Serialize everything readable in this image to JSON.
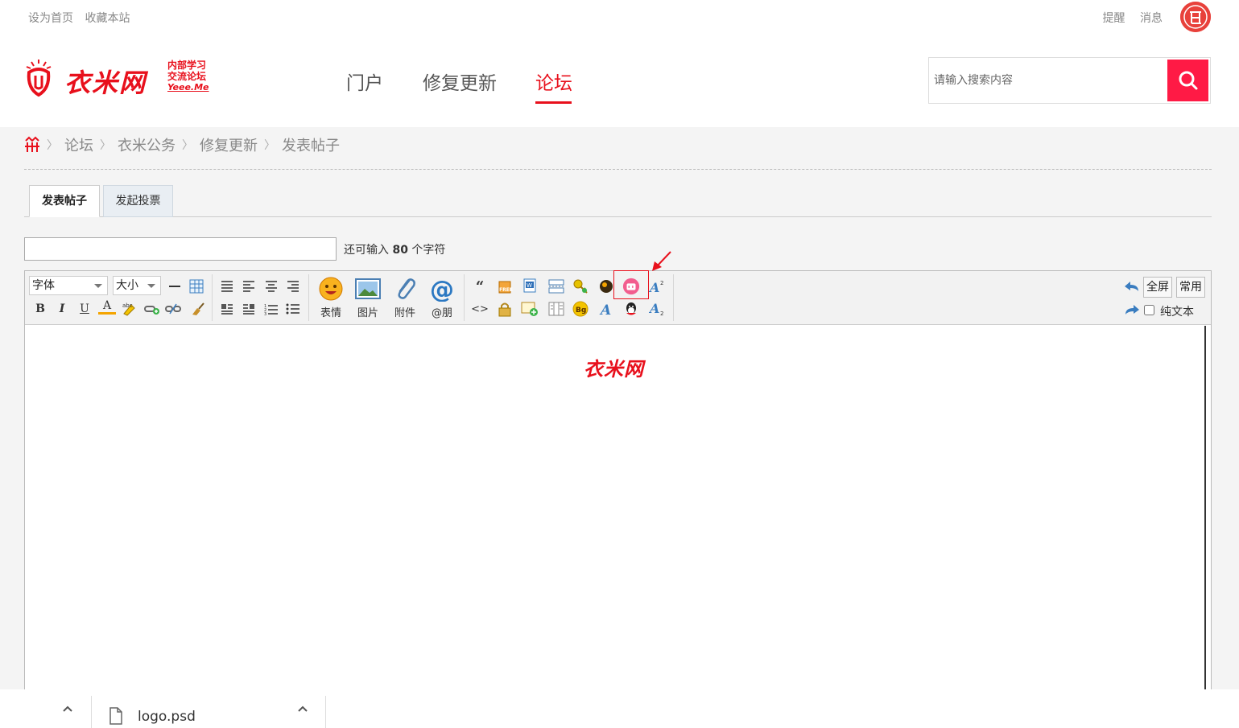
{
  "topbar": {
    "set_home": "设为首页",
    "bookmark": "收藏本站",
    "remind": "提醒",
    "messages": "消息",
    "avatar_glyph": "伀"
  },
  "logo": {
    "name": "衣米网",
    "sub_line1": "内部学习",
    "sub_line2": "交流论坛",
    "sub_url": "Yeee.Me"
  },
  "nav": {
    "items": [
      {
        "label": "门户",
        "active": false
      },
      {
        "label": "修复更新",
        "active": false
      },
      {
        "label": "论坛",
        "active": true
      }
    ]
  },
  "search": {
    "placeholder": "请输入搜索内容",
    "button_icon": "search-icon"
  },
  "breadcrumb": {
    "home_icon": "home-icon",
    "items": [
      "论坛",
      "衣米公务",
      "修复更新",
      "发表帖子"
    ]
  },
  "tabs": [
    {
      "label": "发表帖子",
      "active": true
    },
    {
      "label": "发起投票",
      "active": false
    }
  ],
  "subject": {
    "value": "",
    "remain_prefix": "还可输入",
    "remain_count": "80",
    "remain_suffix": "个字符"
  },
  "toolbar": {
    "font_select": "字体",
    "size_select": "大小",
    "bold": "B",
    "italic": "I",
    "underline": "U",
    "font_color": "A",
    "emoji_label": "表情",
    "image_label": "图片",
    "attach_label": "附件",
    "at_label": "@朋",
    "quote": "“",
    "code": "<>",
    "fullscreen": "全屏",
    "common": "常用",
    "plain_text": "纯文本",
    "plain_checked": false
  },
  "editor": {
    "watermark": "衣米网"
  },
  "download_bar": {
    "filename": "logo.psd"
  },
  "colors": {
    "brand_red": "#e8101c",
    "search_button": "#ff1a45",
    "highlight_box": "#e8101c"
  }
}
